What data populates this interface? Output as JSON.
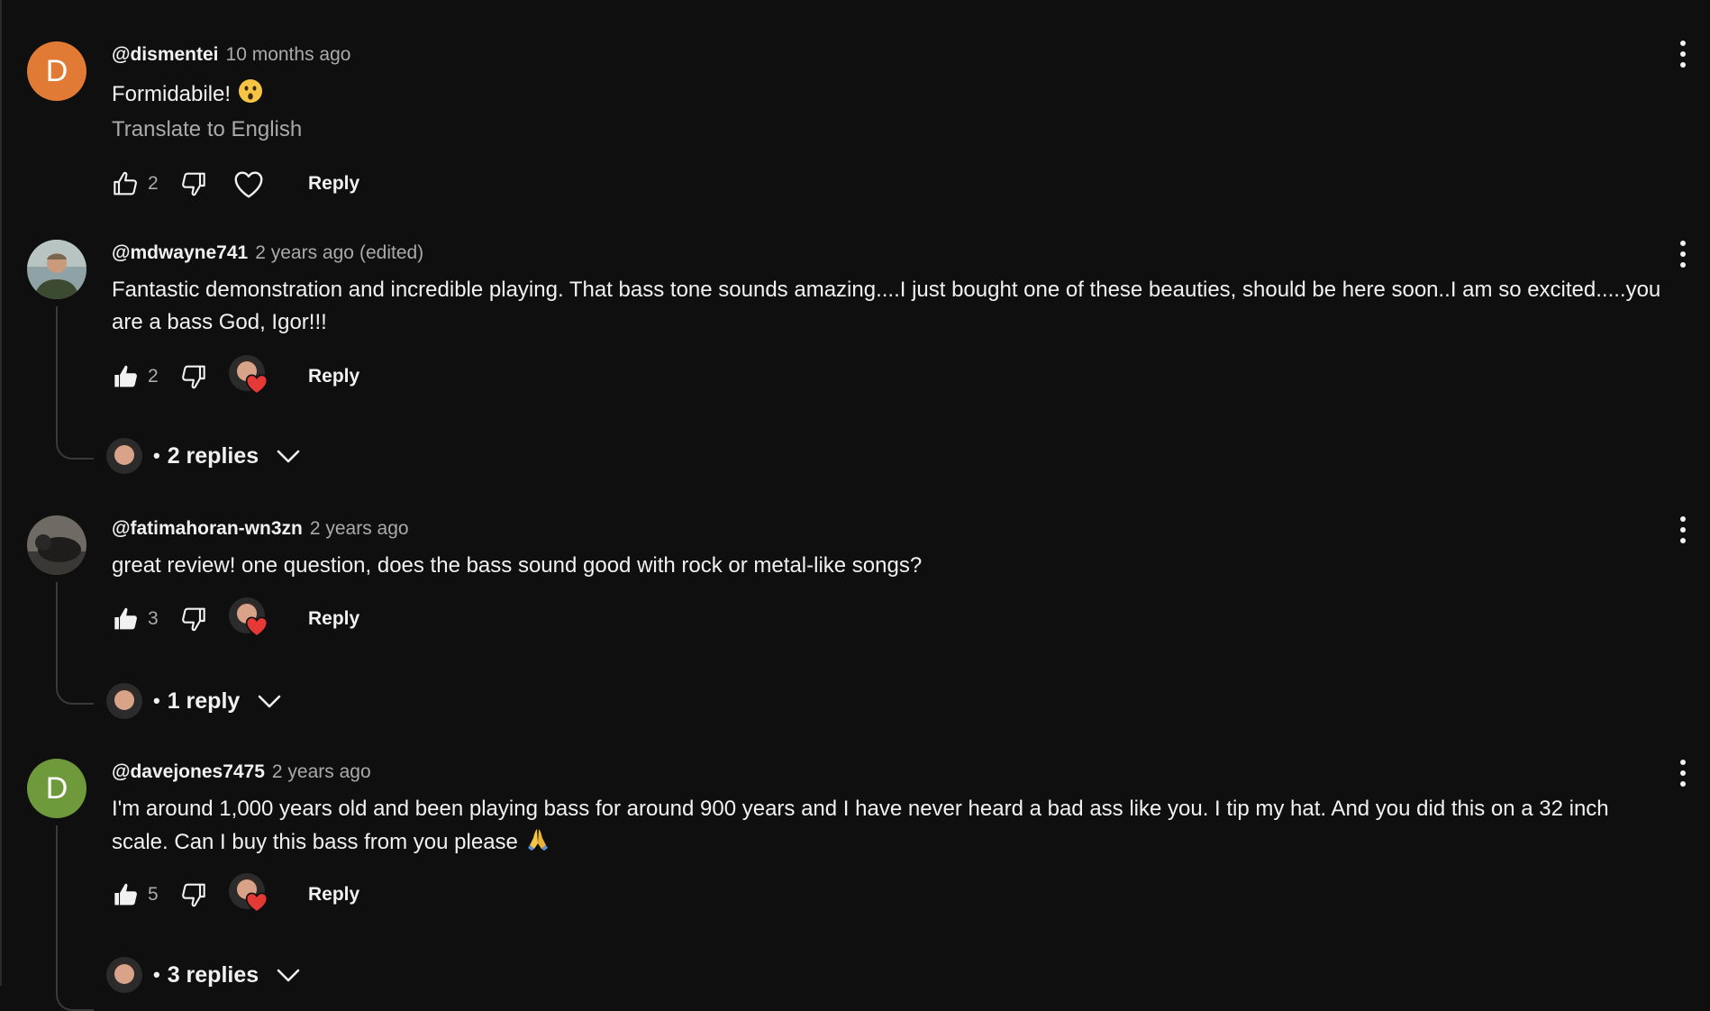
{
  "comments": [
    {
      "author": "@dismentei",
      "time": "10 months ago",
      "edited": "",
      "avatar_letter": "D",
      "avatar_color": "#e07a34",
      "text": "Formidabile!",
      "emoji": "astonished-face",
      "translate": "Translate to English",
      "likes": "2",
      "liked": false,
      "reply_label": "Reply",
      "hearted_by_creator": false
    },
    {
      "author": "@mdwayne741",
      "time": "2 years ago",
      "edited": "(edited)",
      "avatar_letter": "",
      "text": "Fantastic demonstration and incredible playing.  That bass tone sounds amazing....I just bought one of these beauties, should be here soon..I am so excited.....you are a bass God, Igor!!!",
      "likes": "2",
      "liked": true,
      "reply_label": "Reply",
      "hearted_by_creator": true,
      "replies_label": "2 replies"
    },
    {
      "author": "@fatimahoran-wn3zn",
      "time": "2 years ago",
      "edited": "",
      "avatar_letter": "",
      "text": "great review! one question, does the bass sound good with rock or metal-like songs?",
      "likes": "3",
      "liked": true,
      "reply_label": "Reply",
      "hearted_by_creator": true,
      "replies_label": "1 reply"
    },
    {
      "author": "@davejones7475",
      "time": "2 years ago",
      "edited": "",
      "avatar_letter": "D",
      "avatar_color": "#6f9a3c",
      "text": "I'm around 1,000 years old and been playing bass for around 900 years and I have never heard a bad ass like you. I tip my hat. And you did this on a 32 inch scale. Can I buy this bass from you please",
      "emoji": "folded-hands",
      "likes": "5",
      "liked": true,
      "reply_label": "Reply",
      "hearted_by_creator": true,
      "replies_label": "3 replies"
    }
  ],
  "colors": {
    "background": "#0f0f0f",
    "text_primary": "#f1f1f1",
    "text_secondary": "#aaaaaa",
    "heart_red": "#e53935"
  }
}
